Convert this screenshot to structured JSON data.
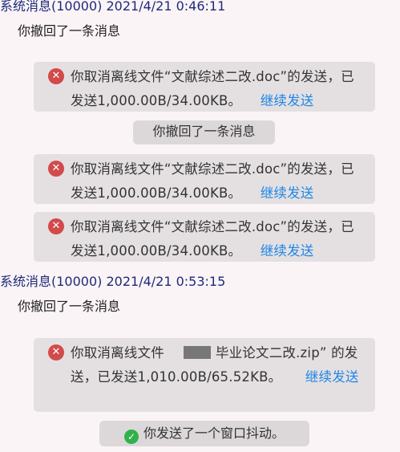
{
  "messages": {
    "header1": "系统消息(10000) 2021/4/21 0:46:11",
    "recall1": "你撤回了一条消息",
    "card1": {
      "text": "你取消离线文件“文献综述二改.doc”的发送，已发送1,000.00B/34.00KB。",
      "link": "继续发送"
    },
    "recall_pill": "你撤回了一条消息",
    "card2": {
      "text": "你取消离线文件“文献综述二改.doc”的发送，已发送1,000.00B/34.00KB。",
      "link": "继续发送"
    },
    "card3": {
      "text": "你取消离线文件“文献综述二改.doc”的发送，已发送1,000.00B/34.00KB。",
      "link": "继续发送"
    },
    "header2": "系统消息(10000) 2021/4/21 0:53:15",
    "recall2": "你撤回了一条消息",
    "card4": {
      "text_a": "你取消离线文件",
      "text_b": "毕业论文二改.zip”",
      "text_c": "的发送，已发送1,010.00B/65.52KB。",
      "link": "继续发送"
    },
    "shake": "你发送了一个窗口抖动。"
  },
  "icons": {
    "error": "error-circle-icon",
    "success": "check-circle-icon"
  }
}
